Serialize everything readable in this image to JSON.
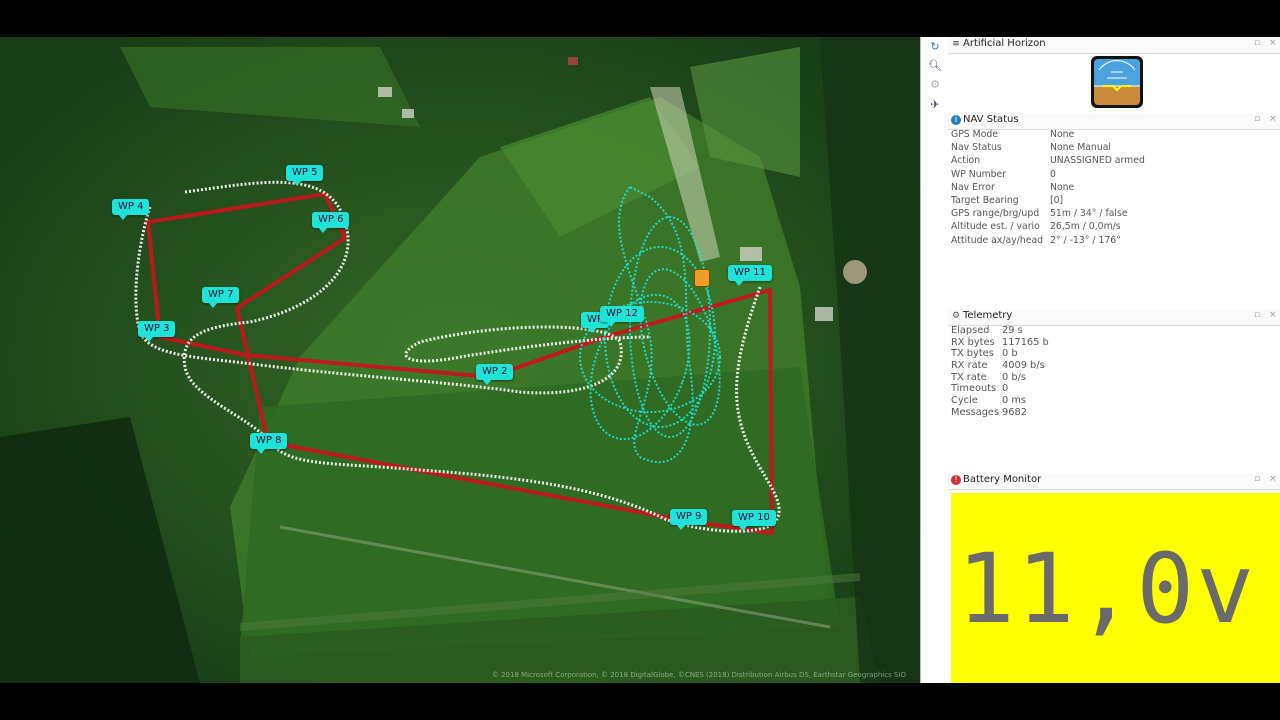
{
  "map": {
    "waypoints": [
      "WP 2",
      "WP 3",
      "WP 4",
      "WP 5",
      "WP 6",
      "WP 7",
      "WP 8",
      "WP 9",
      "WP 10",
      "WP 11",
      "WP 12",
      "WP"
    ],
    "attribution": "© 2018 Microsoft Corporation, © 2018 DigitalGlobe, ©CNES (2018) Distribution Airbus DS, Earthstar Geographics SIO",
    "colors": {
      "route": "#c4161c",
      "track": "#ffffff",
      "waypoint": "#1fe3d9",
      "uav": "#f0a020"
    }
  },
  "toolbar": {
    "icons": [
      "refresh-icon",
      "search-icon",
      "gear-icon",
      "connect-icon"
    ]
  },
  "horizon": {
    "title": "Artificial Horizon",
    "icon": "menu-icon"
  },
  "nav": {
    "title": "NAV Status",
    "icon": "info-icon",
    "rows": [
      {
        "k": "GPS Mode",
        "v": "None"
      },
      {
        "k": "Nav Status",
        "v": "None Manual"
      },
      {
        "k": "Action",
        "v": "UNASSIGNED armed"
      },
      {
        "k": "WP Number",
        "v": "0"
      },
      {
        "k": "Nav Error",
        "v": "None"
      },
      {
        "k": "Target Bearing",
        "v": "[0]"
      },
      {
        "k": "GPS range/brg/upd",
        "v": "51m / 34° / false"
      },
      {
        "k": "Altitude est. / vario",
        "v": "26,5m / 0,0m/s"
      },
      {
        "k": "Attitude ax/ay/head",
        "v": "2° / -13° / 176°"
      }
    ]
  },
  "telemetry": {
    "title": "Telemetry",
    "icon": "gears-icon",
    "rows": [
      {
        "k": "Elapsed",
        "v": "29 s"
      },
      {
        "k": "RX bytes",
        "v": "117165 b"
      },
      {
        "k": "TX bytes",
        "v": "0 b"
      },
      {
        "k": "RX rate",
        "v": "4009 b/s"
      },
      {
        "k": "TX rate",
        "v": "0 b/s"
      },
      {
        "k": "Timeouts",
        "v": "0"
      },
      {
        "k": "Cycle",
        "v": "0 ms"
      },
      {
        "k": "Messages",
        "v": "9682"
      }
    ]
  },
  "battery": {
    "title": "Battery Monitor",
    "icon": "alert-icon",
    "value": "11,0v",
    "bg_color": "#ffff00"
  }
}
